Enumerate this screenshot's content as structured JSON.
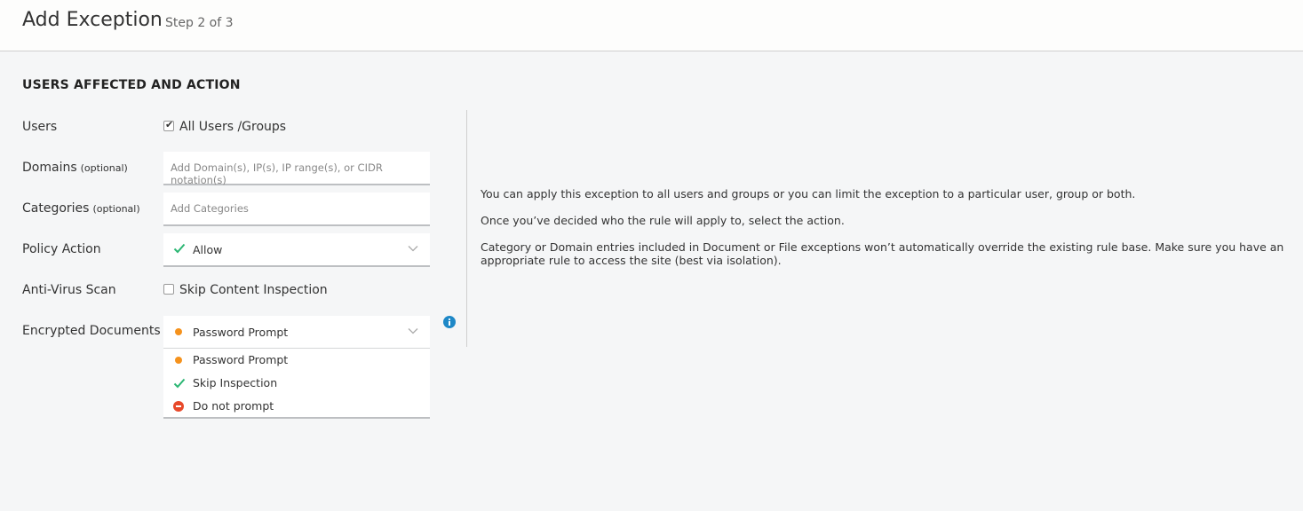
{
  "header": {
    "title": "Add Exception",
    "step": "Step 2 of 3"
  },
  "section": {
    "title": "USERS AFFECTED AND ACTION"
  },
  "form": {
    "users": {
      "label": "Users",
      "checkbox_label": "All Users /Groups",
      "checked": true
    },
    "domains": {
      "label": "Domains",
      "optional": "(optional)",
      "placeholder": "Add Domain(s), IP(s), IP range(s), or CIDR notation(s)"
    },
    "categories": {
      "label": "Categories",
      "optional": "(optional)",
      "placeholder": "Add Categories"
    },
    "policy_action": {
      "label": "Policy Action",
      "value": "Allow",
      "icon": "check-icon",
      "color": "#2bb673"
    },
    "antivirus": {
      "label": "Anti-Virus Scan",
      "checkbox_label": "Skip Content Inspection",
      "checked": false
    },
    "encrypted": {
      "label": "Encrypted Documents",
      "value": "Password Prompt",
      "options": [
        {
          "label": "Password Prompt",
          "icon": "orange-dot-icon",
          "color": "#f5921d"
        },
        {
          "label": "Skip Inspection",
          "icon": "check-icon",
          "color": "#2bb673"
        },
        {
          "label": "Do not prompt",
          "icon": "no-entry-icon",
          "color": "#e8492a"
        }
      ]
    }
  },
  "help": {
    "p1": "You can apply this exception to all users and groups or you can limit the exception to a particular user, group or both.",
    "p2": "Once you’ve decided who the rule will apply to, select the action.",
    "p3": "Category or Domain entries included in Document or File exceptions won’t automatically override the existing rule base. Make sure you have an appropriate rule to access the site (best via isolation)."
  },
  "colors": {
    "accent_info": "#1e88c7",
    "check_green": "#2bb673",
    "orange": "#f5921d",
    "red": "#e8492a"
  }
}
